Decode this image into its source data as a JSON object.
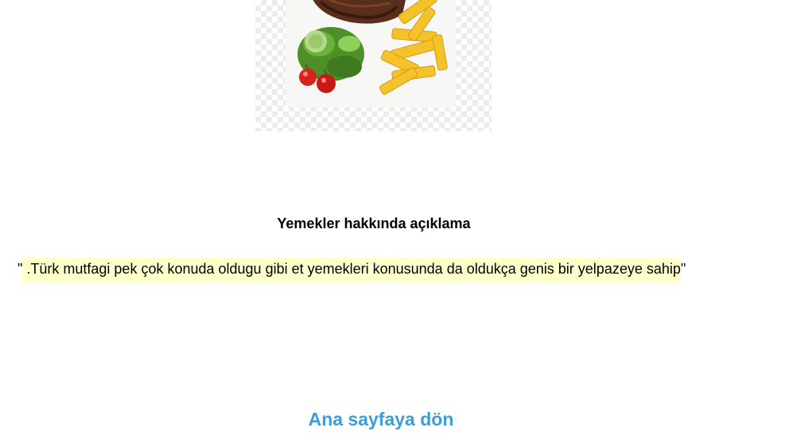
{
  "image": {
    "alt": "",
    "icon": "food-plate-image"
  },
  "description": {
    "title": "Yemekler hakkında açıklama",
    "open_quote": "\"",
    "text": " .Türk mutfagi pek çok konuda oldugu gibi et yemekleri konusunda da oldukça genis bir yelpazeye sahip",
    "close_quote": "\""
  },
  "nav": {
    "home_link": "Ana sayfaya dön"
  },
  "colors": {
    "highlight": "#ffffcc",
    "link": "#3d9ddb"
  }
}
